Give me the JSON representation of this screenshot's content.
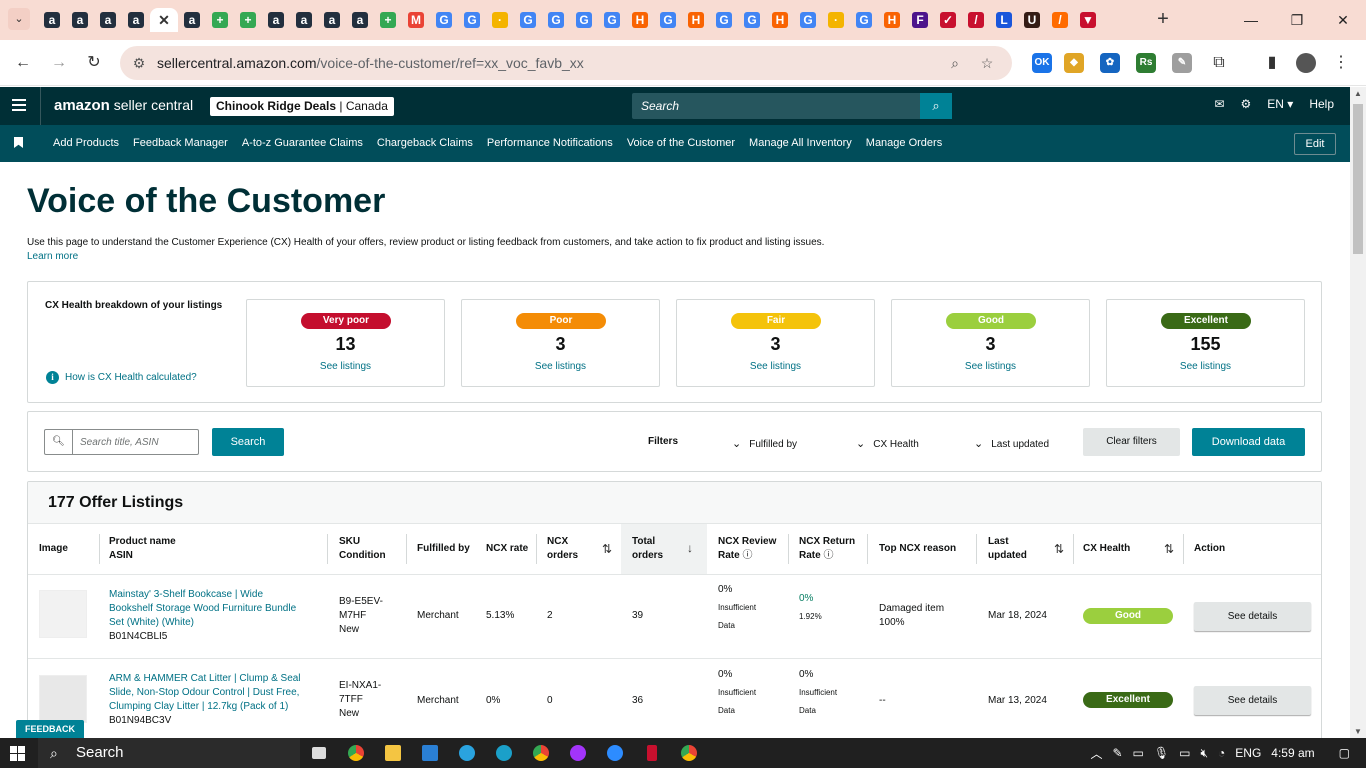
{
  "browser": {
    "url_host": "sellercentral.amazon.com",
    "url_path": "/voice-of-the-customer/ref=xx_voc_favb_xx",
    "active_tab_close": "✕",
    "new_tab": "+",
    "tab_favicons": [
      {
        "glyph": "a",
        "color": "#232f3e"
      },
      {
        "glyph": "a",
        "color": "#232f3e"
      },
      {
        "glyph": "a",
        "color": "#232f3e"
      },
      {
        "glyph": "a",
        "color": "#232f3e"
      },
      {
        "glyph": "✕",
        "color": "active"
      },
      {
        "glyph": "a",
        "color": "#232f3e"
      },
      {
        "glyph": "+",
        "color": "#34a853"
      },
      {
        "glyph": "+",
        "color": "#34a853"
      },
      {
        "glyph": "a",
        "color": "#232f3e"
      },
      {
        "glyph": "a",
        "color": "#232f3e"
      },
      {
        "glyph": "a",
        "color": "#232f3e"
      },
      {
        "glyph": "a",
        "color": "#232f3e"
      },
      {
        "glyph": "+",
        "color": "#34a853"
      },
      {
        "glyph": "M",
        "color": "#ea4335"
      },
      {
        "glyph": "G",
        "color": "#4285f4"
      },
      {
        "glyph": "G",
        "color": "#4285f4"
      },
      {
        "glyph": "·",
        "color": "#f4b400"
      },
      {
        "glyph": "G",
        "color": "#4285f4"
      },
      {
        "glyph": "G",
        "color": "#4285f4"
      },
      {
        "glyph": "G",
        "color": "#4285f4"
      },
      {
        "glyph": "G",
        "color": "#4285f4"
      },
      {
        "glyph": "H",
        "color": "#f96302"
      },
      {
        "glyph": "G",
        "color": "#4285f4"
      },
      {
        "glyph": "H",
        "color": "#f96302"
      },
      {
        "glyph": "G",
        "color": "#4285f4"
      },
      {
        "glyph": "G",
        "color": "#4285f4"
      },
      {
        "glyph": "H",
        "color": "#f96302"
      },
      {
        "glyph": "G",
        "color": "#4285f4"
      },
      {
        "glyph": "·",
        "color": "#f4b400"
      },
      {
        "glyph": "G",
        "color": "#4285f4"
      },
      {
        "glyph": "H",
        "color": "#f96302"
      },
      {
        "glyph": "F",
        "color": "#4d148c"
      },
      {
        "glyph": "✓",
        "color": "#c8102e"
      },
      {
        "glyph": "/",
        "color": "#c8102e"
      },
      {
        "glyph": "L",
        "color": "#1a56db"
      },
      {
        "glyph": "U",
        "color": "#351c15"
      },
      {
        "glyph": "/",
        "color": "#ff6b00"
      },
      {
        "glyph": "▼",
        "color": "#c8102e"
      }
    ],
    "extensions": [
      {
        "glyph": "OK",
        "color": "#1a73e8"
      },
      {
        "glyph": "◆",
        "color": "#e0a526"
      },
      {
        "glyph": "✿",
        "color": "#1565c0"
      },
      {
        "glyph": "Rs",
        "color": "#2e7d32"
      },
      {
        "glyph": "✎",
        "color": "#9e9e9e"
      },
      {
        "glyph": "⧉",
        "color": "#5f6368"
      }
    ]
  },
  "header": {
    "logo_main": "amazon",
    "logo_sub": "seller central",
    "store_name": "Chinook Ridge Deals",
    "store_region": "Canada",
    "search_placeholder": "Search",
    "lang": "EN ▾",
    "help": "Help"
  },
  "nav": {
    "links": [
      "Add Products",
      "Feedback Manager",
      "A-to-z Guarantee Claims",
      "Chargeback Claims",
      "Performance Notifications",
      "Voice of the Customer",
      "Manage All Inventory",
      "Manage Orders"
    ],
    "edit": "Edit"
  },
  "page": {
    "title": "Voice of the Customer",
    "description": "Use this page to understand the Customer Experience (CX) Health of your offers, review product or listing feedback from customers, and take action to fix product and listing issues.",
    "learn_more": "Learn more"
  },
  "cx": {
    "label": "CX Health breakdown of your listings",
    "how": "How is CX Health calculated?",
    "cards": [
      {
        "label": "Very poor",
        "count": "13",
        "see": "See listings",
        "color": "#c40e2e"
      },
      {
        "label": "Poor",
        "count": "3",
        "see": "See listings",
        "color": "#f48c06"
      },
      {
        "label": "Fair",
        "count": "3",
        "see": "See listings",
        "color": "#f4c30b"
      },
      {
        "label": "Good",
        "count": "3",
        "see": "See listings",
        "color": "#9bcf3e"
      },
      {
        "label": "Excellent",
        "count": "155",
        "see": "See listings",
        "color": "#3a6a16"
      }
    ]
  },
  "filters": {
    "search_placeholder": "Search title, ASIN",
    "search_btn": "Search",
    "label": "Filters",
    "fulfilled_by": "Fulfilled by",
    "cx_health": "CX Health",
    "last_updated": "Last updated",
    "clear": "Clear filters",
    "download": "Download data"
  },
  "listings": {
    "title": "177 Offer Listings",
    "columns": {
      "image": "Image",
      "product_name": "Product name",
      "asin": "ASIN",
      "sku": "SKU",
      "condition": "Condition",
      "fulfilled_by": "Fulfilled by",
      "ncx_rate": "NCX rate",
      "ncx_orders_1": "NCX",
      "ncx_orders_2": "orders",
      "total_orders_1": "Total",
      "total_orders_2": "orders",
      "review_rate_1": "NCX Review",
      "review_rate_2": "Rate",
      "return_rate_1": "NCX Return",
      "return_rate_2": "Rate",
      "top_reason": "Top NCX reason",
      "last_updated_1": "Last",
      "last_updated_2": "updated",
      "cx_health": "CX Health",
      "action": "Action"
    },
    "rows": [
      {
        "name_lines": [
          "Mainstay' 3-Shelf Bookcase | Wide",
          "Bookshelf Storage Wood Furniture Bundle",
          "Set (White) (White)"
        ],
        "asin": "B01N4CBLI5",
        "sku_lines": [
          "B9-E5EV-",
          "M7HF"
        ],
        "condition": "New",
        "fulfilled": "Merchant",
        "ncx_rate": "5.13%",
        "ncx_orders": "2",
        "total_orders": "39",
        "review_lines": [
          "0%",
          "Insufficient",
          "Data"
        ],
        "return_lines": [
          "0%",
          "1.92%"
        ],
        "reason_lines": [
          "Damaged item",
          "100%"
        ],
        "updated": "Mar 18, 2024",
        "cx": "Good",
        "cx_color": "#9bcf3e",
        "action": "See details"
      },
      {
        "name_lines": [
          "ARM & HAMMER Cat Litter | Clump & Seal",
          "Slide, Non-Stop Odour Control | Dust Free,",
          "Clumping Clay Litter | 12.7kg (Pack of 1)"
        ],
        "asin": "B01N94BC3V",
        "sku_lines": [
          "EI-NXA1-",
          "7TFF"
        ],
        "condition": "New",
        "fulfilled": "Merchant",
        "ncx_rate": "0%",
        "ncx_orders": "0",
        "total_orders": "36",
        "review_lines": [
          "0%",
          "Insufficient",
          "Data"
        ],
        "return_lines": [
          "0%",
          "Insufficient",
          "Data"
        ],
        "reason": "--",
        "updated": "Mar 13, 2024",
        "cx": "Excellent",
        "cx_color": "#3a6a16",
        "action": "See details"
      }
    ]
  },
  "feedback": "FEEDBACK ✕",
  "taskbar": {
    "search": "Search",
    "lang": "ENG",
    "time": "4:59 am"
  }
}
